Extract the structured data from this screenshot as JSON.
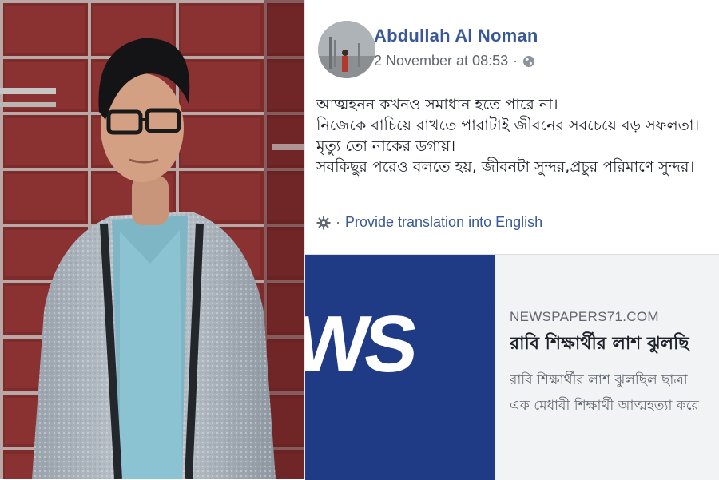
{
  "photo": {
    "subject": "young man with glasses in grey jacket"
  },
  "post": {
    "author": "Abdullah Al Noman",
    "timestamp": "2 November at 08:53",
    "separator": "·",
    "privacy_icon": "globe-icon",
    "lines": [
      "আত্মহনন কখনও সমাধান হতে পারে না।",
      "নিজেকে বাচিয়ে রাখতে পারাটাই জীবনের সবচেয়ে বড় সফলতা।",
      "মৃত্যু তো নাকের ডগায়।",
      "সবকিছুর পরেও বলতে হয়, জীবনটা সুন্দর,প্রচুর পরিমাণে সুন্দর।"
    ],
    "translation": {
      "icon": "gear-icon",
      "separator": "·",
      "label": "Provide translation into English"
    }
  },
  "link_preview": {
    "thumbnail_text": "WS",
    "thumbnail_color": "#1f3b86",
    "domain": "NEWSPAPERS71.COM",
    "title": "রাবি শিক্ষার্থীর লাশ ঝুলছি",
    "description_lines": [
      "রাবি শিক্ষার্থীর লাশ ঝুলছিল ছাত্রা",
      "এক মেধাবী শিক্ষার্থী আত্মহত্যা করে"
    ]
  },
  "colors": {
    "link_blue": "#385898",
    "meta_grey": "#616770",
    "card_bg": "#f2f3f5"
  }
}
